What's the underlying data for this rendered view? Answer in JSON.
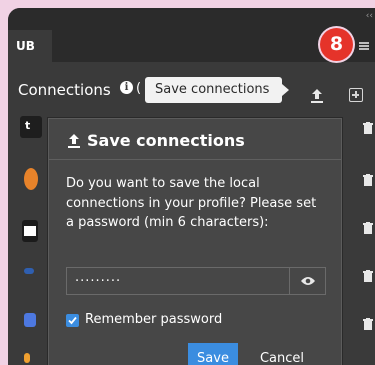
{
  "tab": {
    "label": "UB"
  },
  "step_badge": "8",
  "header": {
    "title": "Connections",
    "paren": "("
  },
  "tooltip": "Save connections",
  "dialog": {
    "title": "Save connections",
    "message": "Do you want to save the local connections in your profile? Please set a password (min 6 characters):",
    "password_value": "·········",
    "remember_label": "Remember password",
    "remember_checked": true,
    "save_label": "Save",
    "cancel_label": "Cancel"
  },
  "colors": {
    "accent": "#3b8de0",
    "badge": "#e5332a",
    "panel": "#3a3a3a"
  },
  "icons": [
    "upload-icon",
    "add-icon",
    "info-icon",
    "eye-icon",
    "trash-icon",
    "menu-icon"
  ]
}
